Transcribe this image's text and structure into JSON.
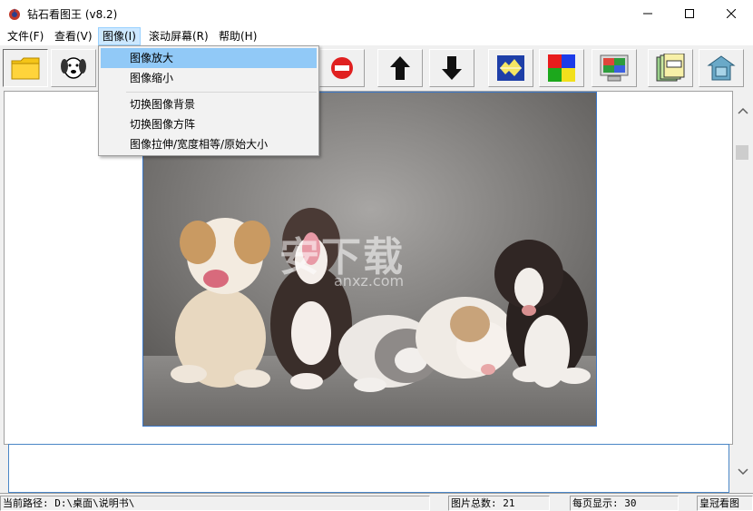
{
  "window": {
    "title": "钻石看图王 (v8.2)"
  },
  "menubar": {
    "items": [
      {
        "label": "文件(F)"
      },
      {
        "label": "查看(V)"
      },
      {
        "label": "图像(I)"
      },
      {
        "label": "滚动屏幕(R)"
      },
      {
        "label": "帮助(H)"
      }
    ]
  },
  "image_menu": {
    "items": [
      {
        "label": "图像放大"
      },
      {
        "label": "图像缩小"
      },
      {
        "label": "切换图像背景"
      },
      {
        "label": "切换图像方阵"
      },
      {
        "label": "图像拉伸/宽度相等/原始大小"
      }
    ]
  },
  "toolbar": {
    "icons": [
      "folder-icon",
      "dog-icon",
      "stop-icon",
      "up-arrow-icon",
      "down-arrow-icon",
      "slideshow-icon",
      "color-grid-icon",
      "monitor-icon",
      "labels-icon",
      "house-icon"
    ]
  },
  "photo": {
    "watermark": "安下载",
    "watermark_sub": "anxz.com"
  },
  "status": {
    "path": "当前路径: D:\\桌面\\说明书\\",
    "total": "图片总数: 21",
    "per_page": "每页显示: 30",
    "brand": "皇冠看图"
  },
  "colors": {
    "menu_highlight": "#91c9f7",
    "active_menu": "#cce8ff",
    "photo_border": "#3c78c8"
  }
}
